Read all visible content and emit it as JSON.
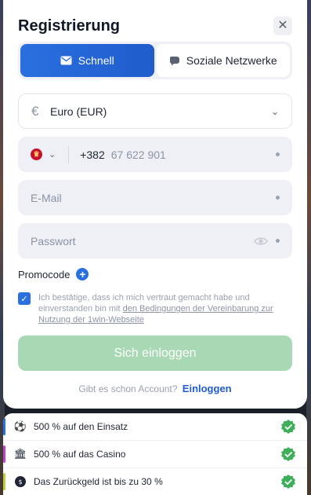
{
  "title": "Registrierung",
  "tabs": [
    {
      "label": "Schnell",
      "icon": "envelope-icon",
      "active": true
    },
    {
      "label": "Soziale Netzwerke",
      "icon": "chat-bubble-icon",
      "active": false
    }
  ],
  "currency": {
    "value": "Euro (EUR)",
    "icon": "euro-icon"
  },
  "phone": {
    "country_code": "+382",
    "placeholder": "67 622 901"
  },
  "email": {
    "placeholder": "E-Mail"
  },
  "password": {
    "placeholder": "Passwort"
  },
  "promocode": {
    "label": "Promocode"
  },
  "consent": {
    "checked": true,
    "text": "Ich bestätige, dass ich mich vertraut gemacht habe und einverstanden bin mit ",
    "link": "den Bedingungen der Vereinbarung zur Nutzung der 1win-Webseite"
  },
  "submit_label": "Sich einloggen",
  "login_prompt": "Gibt es schon Account?",
  "login_link": "Einloggen",
  "bonuses": [
    {
      "text": "500 % auf den Einsatz",
      "icon": "soccer-ball-icon",
      "accent": "#2a6fe0"
    },
    {
      "text": "500 % auf das Casino",
      "icon": "casino-icon",
      "accent": "#c43ec9"
    },
    {
      "text": "Das Zurückgeld ist bis zu 30 %",
      "icon": "cashback-icon",
      "accent": "#b7d23a"
    }
  ],
  "colors": {
    "accent": "#2a6fe0",
    "success": "#3fae5a",
    "submit_disabled": "#a8d8b4"
  }
}
